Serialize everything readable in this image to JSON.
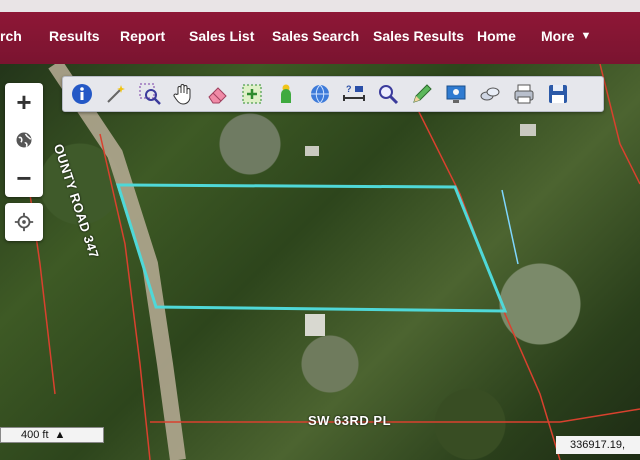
{
  "nav": {
    "items": [
      "rch",
      "Results",
      "Report",
      "Sales List",
      "Sales Search",
      "Sales Results",
      "Home",
      "More"
    ]
  },
  "toolbar": {
    "tools": [
      "info-icon",
      "magic-wand-icon",
      "zoom-select-icon",
      "pan-hand-icon",
      "eraser-icon",
      "select-add-icon",
      "person-icon",
      "globe-icon",
      "measure-icon",
      "magnify-icon",
      "pencil-icon",
      "monitor-icon",
      "layers-icon",
      "print-icon",
      "save-icon"
    ]
  },
  "zoom": {
    "in_label": "+",
    "out_label": "−"
  },
  "map": {
    "road_label": "OUNTY ROAD 347",
    "street_label": "SW 63RD PL",
    "parcel_color": "#4fd8d8",
    "property_line_color": "#d9412e"
  },
  "scale": {
    "label": "400 ft"
  },
  "coords": {
    "value": "336917.19,"
  },
  "colors": {
    "nav_bg": "#8e1736",
    "toolbar_bg": "#e6e7ec"
  }
}
